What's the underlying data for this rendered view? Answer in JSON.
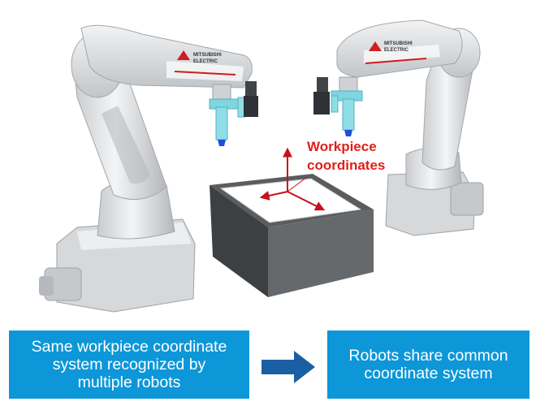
{
  "diagram": {
    "workpiece_label": [
      "Workpiece",
      "coordinates"
    ],
    "robot_logo_text": "MITSUBISHI ELECTRIC",
    "caption_left": [
      "Same workpiece coordinate",
      "system recognized by",
      "multiple robots"
    ],
    "caption_right": [
      "Robots share common",
      "coordinate system"
    ]
  },
  "colors": {
    "caption_fill": "#0d97d8",
    "arrow": "#1a5fa3",
    "axis": "#c8101a",
    "label": "#e0201a"
  }
}
